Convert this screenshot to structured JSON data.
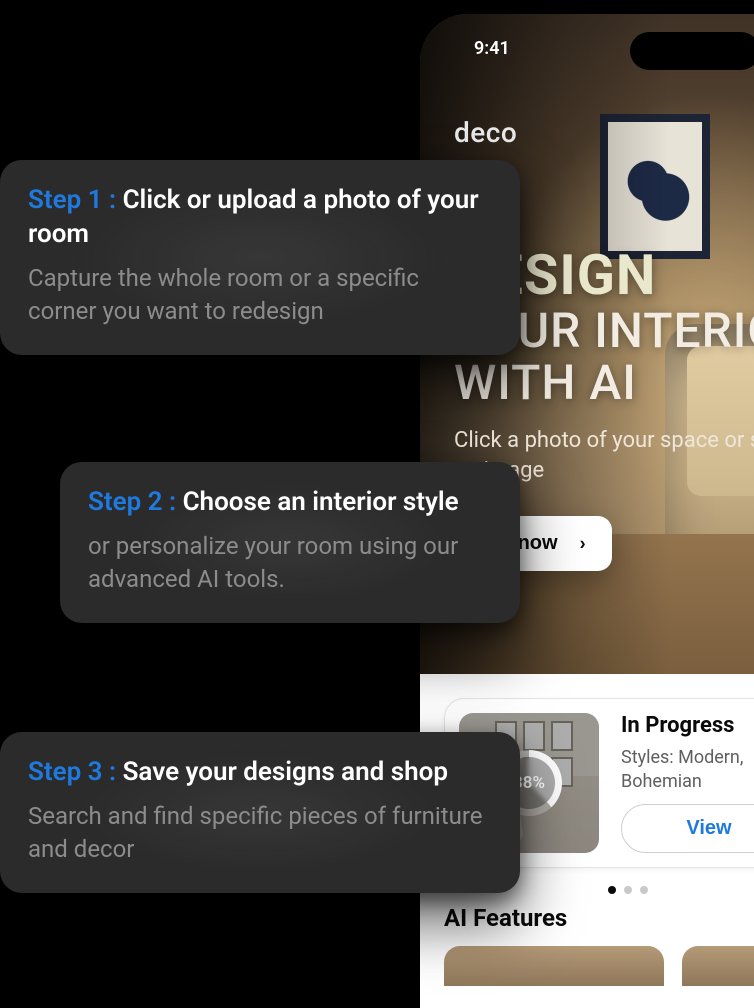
{
  "phone": {
    "status_time": "9:41",
    "logo": "deco",
    "hero": {
      "headline_l1": "DESIGN",
      "headline_l2": "YOUR INTERIOR",
      "headline_l3": "WITH AI",
      "subhead": "Click a photo of your space or select an image",
      "cta_label": "Try now"
    },
    "progress": {
      "percent_label": "38%",
      "title": "In Progress",
      "subtitle": "Styles: Modern, Bohemian",
      "view_label": "View"
    },
    "section_title": "AI Features"
  },
  "steps": [
    {
      "label": "Step 1 :",
      "title": "Click or upload a photo of your room",
      "desc": "Capture the whole room or a specific corner you want to redesign"
    },
    {
      "label": "Step 2 :",
      "title": "Choose an interior style",
      "desc": "or personalize your room using our advanced AI tools."
    },
    {
      "label": "Step 3 :",
      "title": "Save your designs and shop",
      "desc": "Search and find specific pieces of furniture and decor"
    }
  ],
  "colors": {
    "accent": "#1f7ae0"
  }
}
